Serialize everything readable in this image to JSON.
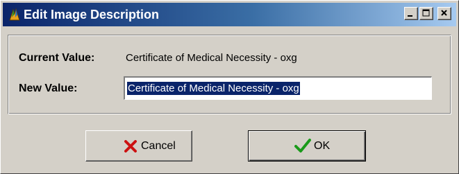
{
  "window": {
    "title": "Edit Image Description",
    "title_icon": "app-icon"
  },
  "caption_buttons": {
    "minimize_icon": "minimize-icon",
    "maximize_icon": "maximize-icon",
    "close_icon": "close-icon"
  },
  "form": {
    "current_label": "Current Value:",
    "current_value": "Certificate of Medical Necessity - oxg",
    "new_label": "New Value:",
    "new_value": "Certificate of Medical Necessity - oxg"
  },
  "buttons": {
    "cancel_label": "Cancel",
    "cancel_icon": "red-x-icon",
    "ok_label": "OK",
    "ok_icon": "green-check-icon"
  },
  "colors": {
    "titlebar_start": "#0a246a",
    "titlebar_end": "#a6caf0",
    "face": "#d4d0c8",
    "selection": "#0a246a",
    "cancel_icon": "#cc1111",
    "ok_icon": "#1a9a1a"
  }
}
